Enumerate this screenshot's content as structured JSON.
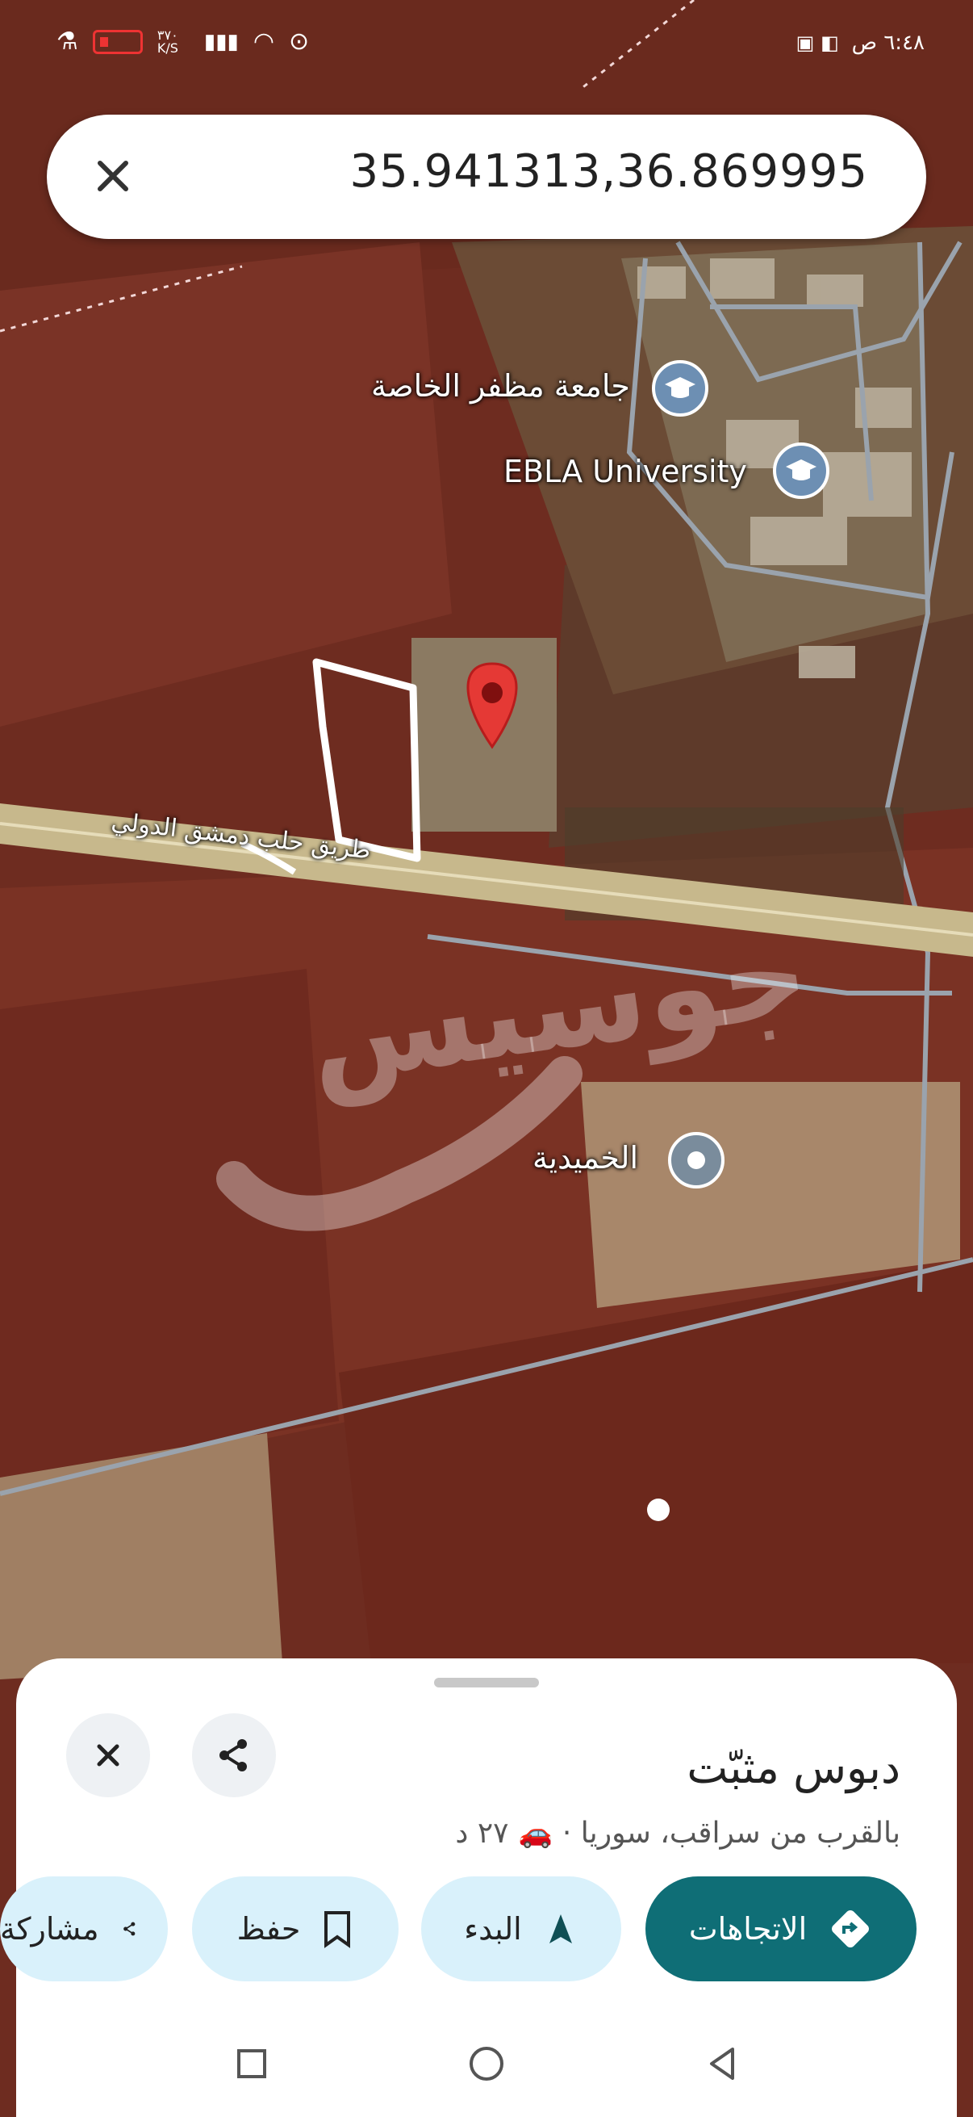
{
  "status_bar": {
    "time": "٦:٤٨ ص",
    "net_speed": "٣٧٠ K/S"
  },
  "search": {
    "query": "35.941313,36.869995"
  },
  "map": {
    "labels": {
      "mosque_uni": "جامعة مظفر الخاصة",
      "ebla": "EBLA University",
      "khumaydiyah": "الخميدية",
      "highway": "طريق حلب دمشق الدولي",
      "watermark": "جوسيس"
    }
  },
  "place_sheet": {
    "title": "دبوس مثبّت",
    "subtitle_place": "بالقرب من سراقب، سوريا ·",
    "drive_time": "٢٧ د",
    "actions": {
      "directions": "الاتجاهات",
      "start": "البدء",
      "save": "حفظ",
      "share": "مشاركة"
    }
  },
  "colors": {
    "accent": "#0f6e76",
    "chip_bg": "#d9f1fb",
    "pin_red": "#e53935"
  }
}
